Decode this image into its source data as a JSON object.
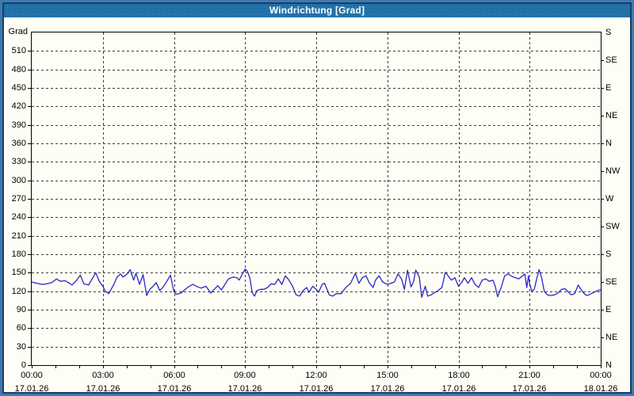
{
  "window": {
    "title": "Windrichtung [Grad]"
  },
  "colors": {
    "titlebar_bg": "#1f6fa6",
    "titlebar_text": "#ffffff",
    "frame_outer": "#3e7ab0",
    "frame_inner": "#1b3d64",
    "background": "#fffef6",
    "grid": "#3c3c3c",
    "axis": "#000000",
    "line": "#2828c8"
  },
  "chart_data": {
    "type": "line",
    "title": "Windrichtung [Grad]",
    "y_axis": {
      "label": "Grad",
      "min": 0,
      "max": 540,
      "tick_step": 30,
      "tick_labels": [
        "0",
        "30",
        "60",
        "90",
        "120",
        "150",
        "180",
        "210",
        "240",
        "270",
        "300",
        "330",
        "360",
        "390",
        "420",
        "450",
        "480",
        "510"
      ]
    },
    "right_axis": {
      "tick_step_degrees": 45,
      "labels_top_to_bottom": [
        "S",
        "SE",
        "E",
        "NE",
        "N",
        "NW",
        "W",
        "SW",
        "S",
        "SE",
        "E",
        "NE",
        "N"
      ]
    },
    "x_axis": {
      "range_hours": [
        0,
        24
      ],
      "major_tick_step_hours": 3,
      "minor_tick_step_hours": 1,
      "major_ticks": [
        {
          "time": "00:00",
          "date": "17.01.26"
        },
        {
          "time": "03:00",
          "date": "17.01.26"
        },
        {
          "time": "06:00",
          "date": "17.01.26"
        },
        {
          "time": "09:00",
          "date": "17.01.26"
        },
        {
          "time": "12:00",
          "date": "17.01.26"
        },
        {
          "time": "15:00",
          "date": "17.01.26"
        },
        {
          "time": "18:00",
          "date": "17.01.26"
        },
        {
          "time": "21:00",
          "date": "17.01.26"
        },
        {
          "time": "00:00",
          "date": "18.01.26"
        }
      ]
    },
    "series": [
      {
        "name": "Windrichtung",
        "unit": "Grad",
        "points": [
          [
            0.0,
            135
          ],
          [
            0.2,
            133
          ],
          [
            0.45,
            131
          ],
          [
            0.65,
            132
          ],
          [
            0.85,
            134
          ],
          [
            1.05,
            140
          ],
          [
            1.2,
            136
          ],
          [
            1.4,
            137
          ],
          [
            1.55,
            134
          ],
          [
            1.7,
            130
          ],
          [
            1.9,
            138
          ],
          [
            2.05,
            146
          ],
          [
            2.2,
            132
          ],
          [
            2.4,
            130
          ],
          [
            2.55,
            140
          ],
          [
            2.7,
            150
          ],
          [
            2.85,
            136
          ],
          [
            3.0,
            128
          ],
          [
            3.1,
            120
          ],
          [
            3.25,
            116
          ],
          [
            3.45,
            130
          ],
          [
            3.6,
            143
          ],
          [
            3.75,
            148
          ],
          [
            3.85,
            143
          ],
          [
            4.0,
            147
          ],
          [
            4.15,
            155
          ],
          [
            4.3,
            138
          ],
          [
            4.4,
            149
          ],
          [
            4.55,
            131
          ],
          [
            4.7,
            147
          ],
          [
            4.85,
            113
          ],
          [
            5.0,
            124
          ],
          [
            5.1,
            127
          ],
          [
            5.25,
            134
          ],
          [
            5.4,
            121
          ],
          [
            5.55,
            127
          ],
          [
            5.7,
            136
          ],
          [
            5.85,
            146
          ],
          [
            6.0,
            119
          ],
          [
            6.1,
            115
          ],
          [
            6.3,
            117
          ],
          [
            6.5,
            124
          ],
          [
            6.65,
            128
          ],
          [
            6.8,
            131
          ],
          [
            7.0,
            127
          ],
          [
            7.15,
            125
          ],
          [
            7.35,
            128
          ],
          [
            7.55,
            117
          ],
          [
            7.7,
            123
          ],
          [
            7.85,
            129
          ],
          [
            8.0,
            122
          ],
          [
            8.15,
            131
          ],
          [
            8.3,
            140
          ],
          [
            8.5,
            143
          ],
          [
            8.65,
            142
          ],
          [
            8.75,
            138
          ],
          [
            8.9,
            149
          ],
          [
            9.0,
            156
          ],
          [
            9.1,
            152
          ],
          [
            9.2,
            142
          ],
          [
            9.3,
            118
          ],
          [
            9.4,
            112
          ],
          [
            9.5,
            121
          ],
          [
            9.65,
            123
          ],
          [
            9.8,
            123
          ],
          [
            9.95,
            126
          ],
          [
            10.1,
            132
          ],
          [
            10.25,
            131
          ],
          [
            10.4,
            140
          ],
          [
            10.55,
            131
          ],
          [
            10.7,
            145
          ],
          [
            10.85,
            138
          ],
          [
            11.0,
            128
          ],
          [
            11.15,
            114
          ],
          [
            11.3,
            112
          ],
          [
            11.45,
            121
          ],
          [
            11.6,
            126
          ],
          [
            11.7,
            118
          ],
          [
            11.85,
            128
          ],
          [
            12.0,
            123
          ],
          [
            12.1,
            118
          ],
          [
            12.25,
            131
          ],
          [
            12.35,
            133
          ],
          [
            12.55,
            114
          ],
          [
            12.7,
            112
          ],
          [
            12.85,
            116
          ],
          [
            13.05,
            116
          ],
          [
            13.25,
            126
          ],
          [
            13.45,
            133
          ],
          [
            13.65,
            149
          ],
          [
            13.8,
            133
          ],
          [
            13.95,
            142
          ],
          [
            14.1,
            145
          ],
          [
            14.25,
            133
          ],
          [
            14.4,
            126
          ],
          [
            14.5,
            138
          ],
          [
            14.65,
            145
          ],
          [
            14.8,
            135
          ],
          [
            15.0,
            131
          ],
          [
            15.15,
            133
          ],
          [
            15.3,
            135
          ],
          [
            15.45,
            148
          ],
          [
            15.6,
            140
          ],
          [
            15.72,
            123
          ],
          [
            15.85,
            154
          ],
          [
            16.0,
            127
          ],
          [
            16.1,
            135
          ],
          [
            16.2,
            154
          ],
          [
            16.35,
            143
          ],
          [
            16.45,
            110
          ],
          [
            16.6,
            128
          ],
          [
            16.7,
            112
          ],
          [
            16.85,
            114
          ],
          [
            17.0,
            118
          ],
          [
            17.1,
            120
          ],
          [
            17.3,
            126
          ],
          [
            17.45,
            151
          ],
          [
            17.6,
            143
          ],
          [
            17.7,
            138
          ],
          [
            17.85,
            142
          ],
          [
            18.0,
            128
          ],
          [
            18.15,
            135
          ],
          [
            18.25,
            142
          ],
          [
            18.4,
            133
          ],
          [
            18.55,
            142
          ],
          [
            18.7,
            131
          ],
          [
            18.85,
            126
          ],
          [
            19.0,
            138
          ],
          [
            19.15,
            140
          ],
          [
            19.3,
            136
          ],
          [
            19.45,
            138
          ],
          [
            19.55,
            128
          ],
          [
            19.65,
            111
          ],
          [
            19.8,
            126
          ],
          [
            19.95,
            145
          ],
          [
            20.1,
            148
          ],
          [
            20.25,
            144
          ],
          [
            20.4,
            142
          ],
          [
            20.55,
            140
          ],
          [
            20.7,
            145
          ],
          [
            20.8,
            148
          ],
          [
            20.88,
            126
          ],
          [
            20.95,
            145
          ],
          [
            21.0,
            132
          ],
          [
            21.1,
            120
          ],
          [
            21.2,
            123
          ],
          [
            21.3,
            140
          ],
          [
            21.4,
            155
          ],
          [
            21.5,
            143
          ],
          [
            21.62,
            120
          ],
          [
            21.75,
            114
          ],
          [
            21.9,
            113
          ],
          [
            22.05,
            114
          ],
          [
            22.2,
            117
          ],
          [
            22.35,
            123
          ],
          [
            22.5,
            124
          ],
          [
            22.6,
            120
          ],
          [
            22.75,
            114
          ],
          [
            22.9,
            116
          ],
          [
            23.05,
            130
          ],
          [
            23.2,
            121
          ],
          [
            23.35,
            114
          ],
          [
            23.45,
            113
          ],
          [
            23.6,
            116
          ],
          [
            23.75,
            119
          ],
          [
            23.95,
            122
          ],
          [
            24.0,
            122
          ]
        ]
      }
    ]
  }
}
